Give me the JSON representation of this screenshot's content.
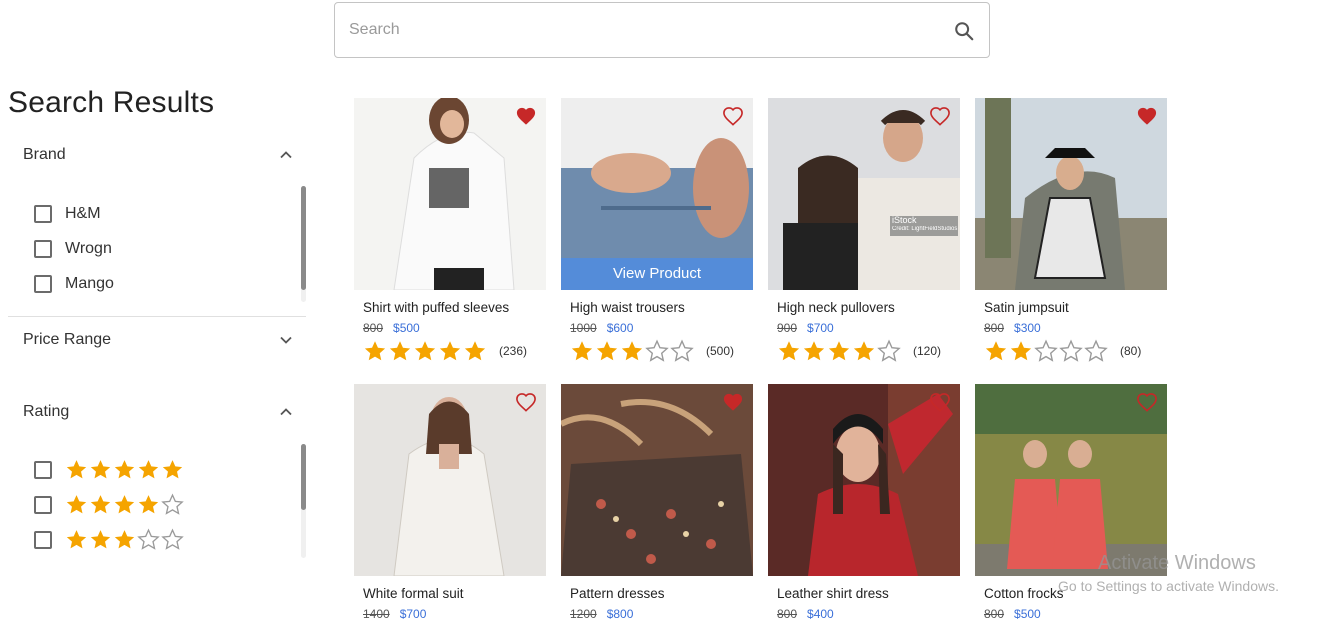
{
  "search": {
    "placeholder": "Search"
  },
  "sidebar": {
    "title": "Search Results",
    "brand": {
      "label": "Brand",
      "options": [
        "H&M",
        "Wrogn",
        "Mango"
      ]
    },
    "price": {
      "label": "Price Range"
    },
    "rating": {
      "label": "Rating",
      "options": [
        5,
        4,
        3
      ]
    }
  },
  "products": [
    {
      "name": "Shirt with puffed sleeves",
      "old_price": "800",
      "price": "$500",
      "rating": 5,
      "reviews": "(236)",
      "favorited": true
    },
    {
      "name": "High waist trousers",
      "old_price": "1000",
      "price": "$600",
      "rating": 3,
      "reviews": "(500)",
      "favorited": false,
      "overlay": "View Product"
    },
    {
      "name": "High neck pullovers",
      "old_price": "900",
      "price": "$700",
      "rating": 4,
      "reviews": "(120)",
      "favorited": false
    },
    {
      "name": "Satin jumpsuit",
      "old_price": "800",
      "price": "$300",
      "rating": 2,
      "reviews": "(80)",
      "favorited": true
    },
    {
      "name": "White formal suit",
      "old_price": "1400",
      "price": "$700",
      "favorited": false
    },
    {
      "name": "Pattern dresses",
      "old_price": "1200",
      "price": "$800",
      "favorited": true
    },
    {
      "name": "Leather shirt dress",
      "old_price": "800",
      "price": "$400",
      "favorited": false
    },
    {
      "name": "Cotton frocks",
      "old_price": "800",
      "price": "$500",
      "favorited": false
    }
  ],
  "photo_watermark": {
    "brand": "iStock",
    "credit": "Credit: LightFieldStudios"
  },
  "watermark": {
    "title": "Activate Windows",
    "subtitle": "Go to Settings to activate Windows."
  },
  "colors": {
    "star": "#f5a400",
    "heart": "#c62828",
    "price": "#3a6fd8"
  }
}
